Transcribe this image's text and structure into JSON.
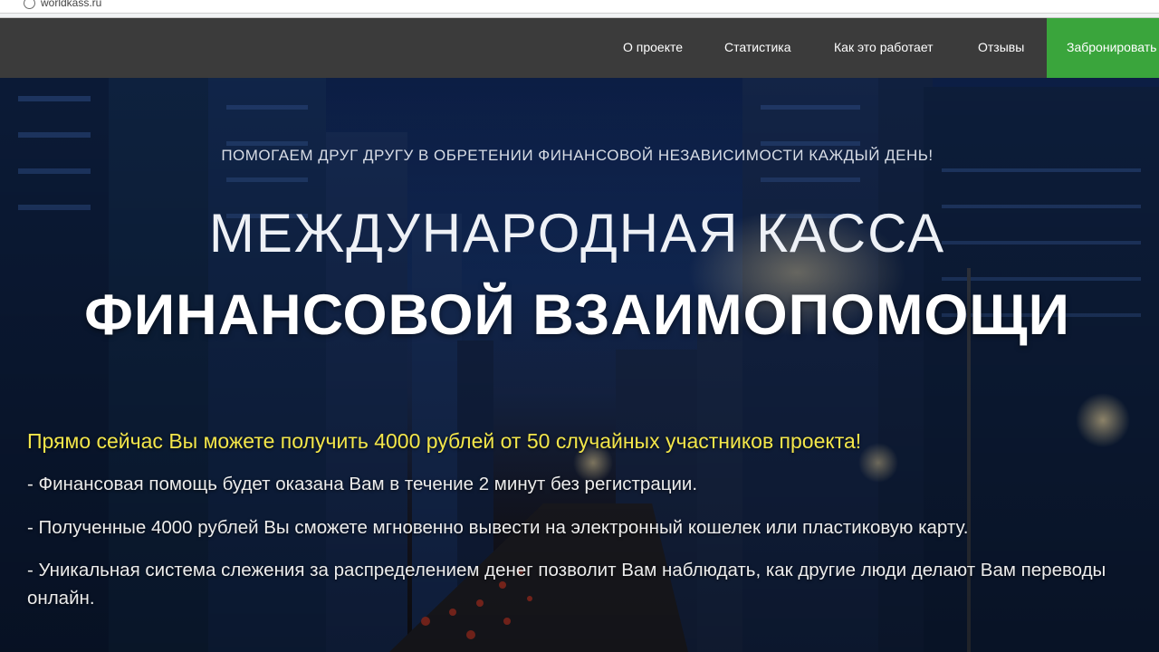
{
  "browser": {
    "url": "worldkass.ru"
  },
  "nav": {
    "items": [
      {
        "label": "О проекте"
      },
      {
        "label": "Статистика"
      },
      {
        "label": "Как это работает"
      },
      {
        "label": "Отзывы"
      }
    ],
    "cta_label": "Забронировать"
  },
  "hero": {
    "tagline": "ПОМОГАЕМ ДРУГ ДРУГУ В ОБРЕТЕНИИ ФИНАНСОВОЙ НЕЗАВИСИМОСТИ КАЖДЫЙ ДЕНЬ!",
    "title_line1": "МЕЖДУНАРОДНАЯ КАССА",
    "title_line2": "ФИНАНСОВОЙ ВЗАИМОПОМОЩИ",
    "offer": "Прямо сейчас Вы можете получить 4000 рублей от 50 случайных участников проекта!",
    "bullets": [
      "- Финансовая помощь будет оказана Вам в течение 2 минут без регистрации.",
      "- Полученные 4000 рублей Вы сможете мгновенно вывести на электронный кошелек или пластиковую карту.",
      "- Уникальная система слежения за распределением денег позволит Вам наблюдать, как другие люди делают Вам переводы онлайн."
    ]
  },
  "colors": {
    "nav_bg": "#3b3b3b",
    "cta_bg": "#3aa53c",
    "offer_text": "#f3e64a"
  }
}
